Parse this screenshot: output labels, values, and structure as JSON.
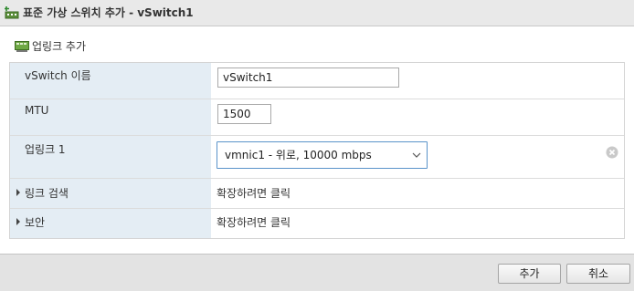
{
  "dialog": {
    "title": "표준 가상 스위치 추가 - vSwitch1",
    "title_icon": "virtual-switch-add-icon"
  },
  "toolbar": {
    "add_uplink_label": "업링크 추가",
    "add_uplink_icon": "network-card-icon"
  },
  "form": {
    "vswitch_name": {
      "label": "vSwitch 이름",
      "value": "vSwitch1"
    },
    "mtu": {
      "label": "MTU",
      "value": "1500"
    },
    "uplink1": {
      "label": "업링크 1",
      "selected": "vmnic1 - 위로, 10000 mbps"
    },
    "link_discovery": {
      "label": "링크 검색",
      "value": "확장하려면 클릭"
    },
    "security": {
      "label": "보안",
      "value": "확장하려면 클릭"
    }
  },
  "footer": {
    "add_label": "추가",
    "cancel_label": "취소"
  },
  "colors": {
    "label_background": "#e4edf4",
    "select_border": "#5a93c9",
    "footer_background": "#e3e3e3"
  }
}
